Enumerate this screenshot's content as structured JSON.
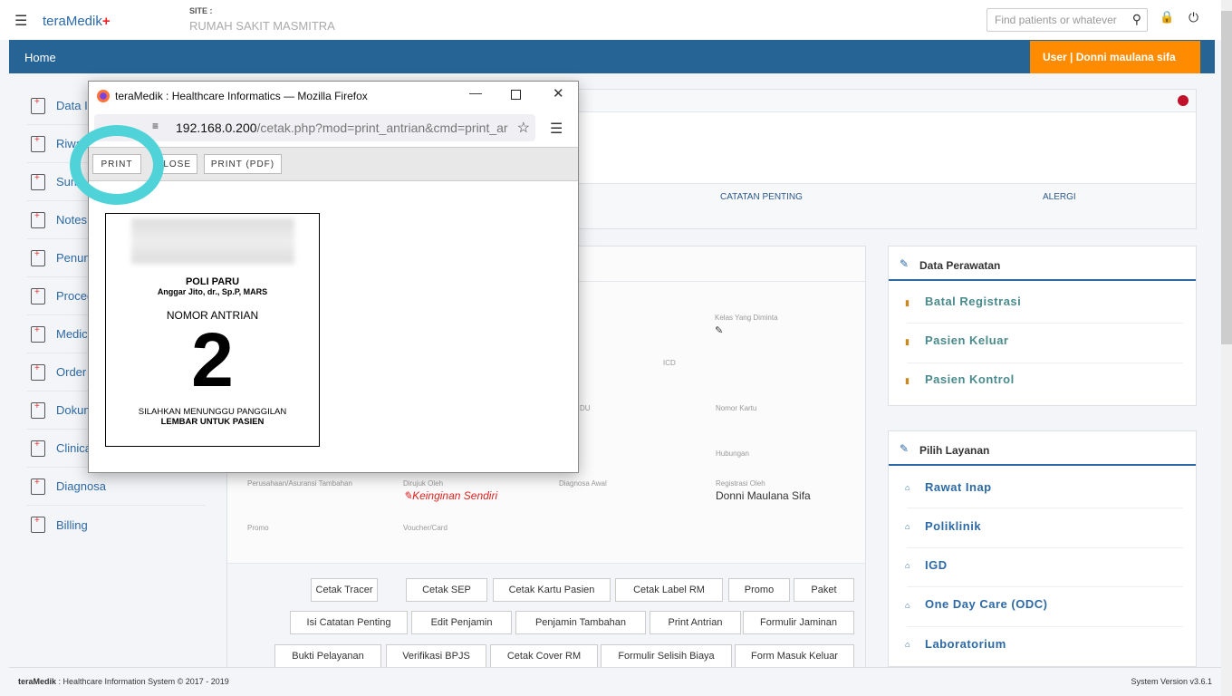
{
  "header": {
    "logo": "teraMedik",
    "site_label": "SITE :",
    "site_name": "RUMAH SAKIT MASMITRA",
    "search_placeholder": "Find patients or whatever"
  },
  "nav": {
    "home": "Home",
    "user": "User | Donni maulana sifa"
  },
  "sidebar": {
    "items": [
      {
        "label": "Data Id"
      },
      {
        "label": "Riwa"
      },
      {
        "label": "Sum"
      },
      {
        "label": "Notes"
      },
      {
        "label": "Penun"
      },
      {
        "label": "Proced"
      },
      {
        "label": "Medica"
      },
      {
        "label": "Order"
      },
      {
        "label": "Dokum"
      },
      {
        "label": "Clinica"
      },
      {
        "label": "Diagnosa"
      },
      {
        "label": "Billing"
      }
    ]
  },
  "summary": {
    "catatan": "CATATAN PENTING",
    "alergi": "ALERGI"
  },
  "form": {
    "kelas": "Kelas Yang Diminta",
    "icd": "ICD",
    "du": "DU",
    "nomor_kartu": "Nomor Kartu",
    "hubungan": "Hubungan",
    "perusahaan": "Perusahaan/Asuransi Tambahan",
    "dirujuk": "Dirujuk Oleh",
    "dirujuk_value": "Keinginan Sendiri",
    "diagnosa": "Diagnosa Awal",
    "registrasi": "Registrasi Oleh",
    "registrasi_value": "Donni Maulana Sifa",
    "promo": "Promo",
    "voucher": "Voucher/Card"
  },
  "actions": {
    "row1": [
      "Cetak Tracer",
      "Cetak SEP",
      "Cetak Kartu Pasien",
      "Cetak Label RM",
      "Promo",
      "Paket"
    ],
    "row2": [
      "Isi Catatan Penting",
      "Edit Penjamin",
      "Penjamin Tambahan",
      "Print Antrian",
      "Formulir Jaminan"
    ],
    "row3": [
      "Bukti Pelayanan",
      "Verifikasi BPJS",
      "Cetak Cover RM",
      "Formulir Selisih Biaya",
      "Form Masuk Keluar"
    ]
  },
  "perawatan": {
    "title": "Data Perawatan",
    "items": [
      "Batal Registrasi",
      "Pasien Keluar",
      "Pasien Kontrol"
    ],
    "color": "#4a8a8c"
  },
  "layanan": {
    "title": "Pilih Layanan",
    "items": [
      "Rawat Inap",
      "Poliklinik",
      "IGD",
      "One Day Care (ODC)",
      "Laboratorium"
    ],
    "color": "#2d6aa5"
  },
  "popup": {
    "title": "teraMedik : Healthcare Informatics — Mozilla Firefox",
    "url_host": "192.168.0.200",
    "url_path": "/cetak.php?mod=print_antrian&cmd=print_ar",
    "print": "PRINT",
    "close": "LOSE",
    "print_pdf": "PRINT (PDF)",
    "ticket": {
      "poli": "POLI PARU",
      "doctor": "Anggar Jito, dr., Sp.P, MARS",
      "heading": "NOMOR ANTRIAN",
      "number": "2",
      "msg1": "SILAHKAN MENUNGGU PANGGILAN",
      "msg2": "LEMBAR UNTUK PASIEN"
    }
  },
  "footer": {
    "brand": "teraMedik",
    "copyright": " : Healthcare Information System © 2017 - 2019",
    "version": "System Version v3.6.1"
  },
  "colors": {
    "nav": "#266496",
    "user_badge": "#ff8c00",
    "highlight_ring": "#4fd3d8"
  }
}
